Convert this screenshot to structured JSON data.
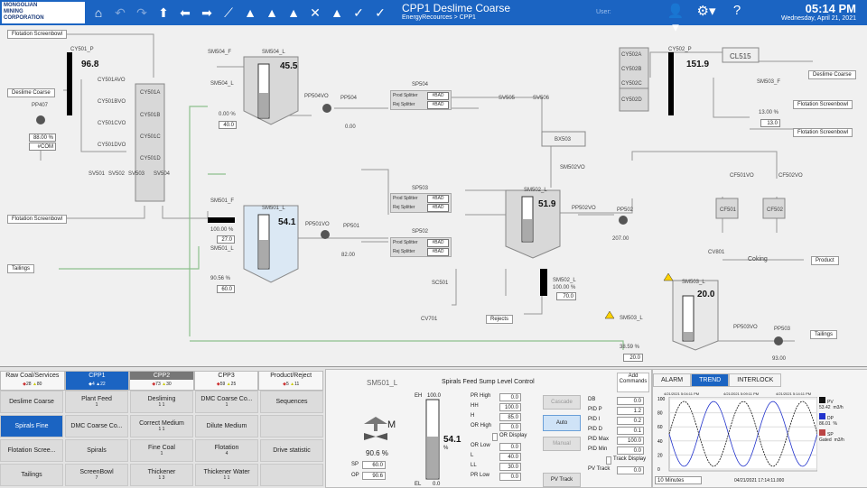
{
  "header": {
    "logo_line1": "MONGOLIAN",
    "logo_line2": "MINING",
    "logo_line3": "CORPORATION",
    "title": "CPP1 Deslime Coarse",
    "breadcrumb": "EnergyRecources > CPP1",
    "user_label": "User:",
    "time": "05:14 PM",
    "date": "Wednesday, April 21, 2021",
    "toolbar_icons": [
      "home-icon",
      "back-icon",
      "forward-icon",
      "up-arrow-icon",
      "left-arrow-icon",
      "right-arrow-icon",
      "trend-icon",
      "alarm-icon",
      "alarm-history-icon",
      "alarm-shelve-icon",
      "alarm-suppress-icon",
      "alarm-summary-icon",
      "acknowledge-icon",
      "acknowledge-all-icon"
    ],
    "right_icons": [
      "user-icon",
      "gear-icon",
      "help-icon"
    ]
  },
  "process": {
    "labels": {
      "flot1": "Flotation Screenbowl",
      "deslime_coarse": "Deslime Coarse",
      "pp407": "PP407",
      "pp407_value": "88.00 %",
      "pp407_mode": "#COM",
      "cy501p": "CY501_P",
      "cy501p_value": "96.8",
      "cy501avo": "CY501AVO",
      "cy501bvo": "CY501BVO",
      "cy501cvo": "CY501CVO",
      "cy501dvo": "CY501DVO",
      "cy501a": "CY501A",
      "cy501b": "CY501B",
      "cy501c": "CY501C",
      "cy501d": "CY501D",
      "sv501": "SV501",
      "sv502": "SV502",
      "sv503": "SV503",
      "sv504": "SV504",
      "flot2": "Flotation Screenbowl",
      "tailings": "Tailings",
      "sm504f": "SM504_F",
      "sm504l_top": "SM504_L",
      "sm504l": "SM504_L",
      "sm504l_value": "45.5",
      "sm504l_pct": "0.00 %",
      "sm504l_sp": "40.0",
      "pp504vo": "PP504VO",
      "pp504": "PP504",
      "pp504_value": "0.00",
      "sp504": "SP504",
      "sv505": "SV505",
      "sv506": "SV506",
      "sm501f": "SM501_F",
      "sm501f_value": "100.00 %",
      "sm501f_sp": "27.0",
      "sm501l_top": "SM501_L",
      "sm501l": "SM501_L",
      "sm501l_value": "54.1",
      "sm501l_pct": "90.56 %",
      "sm501l_sp": "60.0",
      "pp501vo": "PP501VO",
      "pp501": "PP501",
      "pp501_value": "82.00",
      "sp503": "SP503",
      "sp502": "SP502",
      "sc501": "SC501",
      "cv701": "CV701",
      "rejects": "Rejects",
      "sm502l": "SM502_L",
      "sm502l_value": "51.9",
      "sm502l_pct": "100.00 %",
      "sm502l_sp": "70.0",
      "sm502vo": "SM502VO",
      "pp502vo": "PP502VO",
      "pp502": "PP502",
      "pp502_value": "207.00",
      "bx503": "BX503",
      "cy502a": "CY502A",
      "cy502b": "CY502B",
      "cy502c": "CY502C",
      "cy502d": "CY502D",
      "cy502p": "CY502_P",
      "cy502p_value": "151.9",
      "cl515": "CL515",
      "deslime_coarse2": "Deslime Coarse",
      "sm503f": "SM503_F",
      "sm503f_value": "13.00 %",
      "sm503f_sp": "13.0",
      "flot3": "Flotation Screenbowl",
      "flot4": "Flotation Screenbowl",
      "cf501vo": "CF501VO",
      "cf502vo": "CF502VO",
      "cf501": "CF501",
      "cf502": "CF502",
      "cv801": "CV801",
      "coking": "Coking",
      "product": "Product",
      "sm503l": "SM503_L",
      "sm503l_value": "20.0",
      "sm503l_top": "SM503_L",
      "sm503l_pct": "38.59 %",
      "sm503l_sp": "20.0",
      "pp503vo": "PP503VO",
      "pp503": "PP503",
      "pp503_value": "93.00",
      "tailings2": "Tailings",
      "prod_splitter": "Prod Splitter",
      "rej_splitter": "Rej Splitter",
      "bad": "#BAD",
      "pct": "%",
      "s": "S",
      "a": "A",
      "b": "B"
    }
  },
  "nav": {
    "tabs": [
      {
        "label": "Raw Coal/Services",
        "c1": "28",
        "c2": "80"
      },
      {
        "label": "CPP1",
        "c1": "4",
        "c2": "22"
      },
      {
        "label": "CPP2",
        "c1": "73",
        "c2": "30"
      },
      {
        "label": "CPP3",
        "c1": "59",
        "c2": "25"
      },
      {
        "label": "Product/Reject",
        "c1": "5",
        "c2": "11"
      }
    ],
    "buttons": [
      {
        "label": "Deslime Coarse",
        "count": ""
      },
      {
        "label": "Plant Feed",
        "count": "1"
      },
      {
        "label": "Desliming",
        "count": "1 1"
      },
      {
        "label": "DMC Coarse Co...",
        "count": "1"
      },
      {
        "label": "Sequences",
        "count": ""
      },
      {
        "label": "Spirals Fine",
        "count": ""
      },
      {
        "label": "DMC Coarse Co...",
        "count": ""
      },
      {
        "label": "Correct Medium",
        "count": "1 1"
      },
      {
        "label": "Dilute Medium",
        "count": ""
      },
      {
        "label": "",
        "count": ""
      },
      {
        "label": "Flotation Scree...",
        "count": ""
      },
      {
        "label": "Spirals",
        "count": ""
      },
      {
        "label": "Fine Coal",
        "count": "1"
      },
      {
        "label": "Flotation",
        "count": "4"
      },
      {
        "label": "Drive statistic",
        "count": ""
      },
      {
        "label": "Tailings",
        "count": ""
      },
      {
        "label": "ScreenBowl",
        "count": "7"
      },
      {
        "label": "Thickener",
        "count": "1 3"
      },
      {
        "label": "Thickener Water",
        "count": "1 1"
      },
      {
        "label": "",
        "count": ""
      }
    ]
  },
  "faceplate": {
    "tag": "SM501_L",
    "title": "Spirals Feed Sump Level Control",
    "add_commands": "Add Commands",
    "eh": "EH",
    "eh_value": "100.0",
    "el": "EL",
    "el_value": "0.0",
    "pv": "54.1",
    "pv_unit": "%",
    "out_pct": "90.6 %",
    "m": "M",
    "sp_label": "SP",
    "sp": "60.0",
    "op_label": "OP",
    "op": "90.6",
    "limits": [
      {
        "label": "PR High",
        "value": "0.0"
      },
      {
        "label": "HH",
        "value": "100.0"
      },
      {
        "label": "H",
        "value": "85.0"
      },
      {
        "label": "OR High",
        "value": "0.0"
      },
      {
        "label": "OR Display",
        "value": ""
      },
      {
        "label": "OR Low",
        "value": "0.0"
      },
      {
        "label": "L",
        "value": "40.0"
      },
      {
        "label": "LL",
        "value": "30.0"
      },
      {
        "label": "PR Low",
        "value": "0.0"
      }
    ],
    "modes": {
      "cascade": "Cascade",
      "auto": "Auto",
      "manual": "Manual",
      "pvtrack": "PV Track"
    },
    "tuning": [
      {
        "label": "DB",
        "value": "0.0"
      },
      {
        "label": "PID P",
        "value": "1.2"
      },
      {
        "label": "PID I",
        "value": "0.2"
      },
      {
        "label": "PID D",
        "value": "0.1"
      },
      {
        "label": "PID Max",
        "value": "100.0"
      },
      {
        "label": "PID Min",
        "value": "0.0"
      },
      {
        "label": "Track Display",
        "value": ""
      },
      {
        "label": "PV Track",
        "value": "0.0"
      }
    ]
  },
  "trend": {
    "tabs": [
      "ALARM",
      "TREND",
      "INTERLOCK"
    ],
    "start": "4/21/2021 5:04:11 PM",
    "mid": "4/21/2021 5:09:11 PM",
    "end": "4/21/2021 5:14:11 PM",
    "yticks": [
      "100",
      "80",
      "60",
      "40",
      "20",
      "0"
    ],
    "range": "10 Minutes",
    "timestamp": "04/21/2021 17:14:11.000",
    "legend": [
      {
        "name": "PV",
        "value": "53.42",
        "unit": "m3/h",
        "color": "#111111"
      },
      {
        "name": "DP",
        "value": "86.01",
        "unit": "%",
        "color": "#2233cc"
      },
      {
        "name": "SP",
        "value": "Gated",
        "unit": "m3/h",
        "color": "#b44"
      }
    ]
  }
}
